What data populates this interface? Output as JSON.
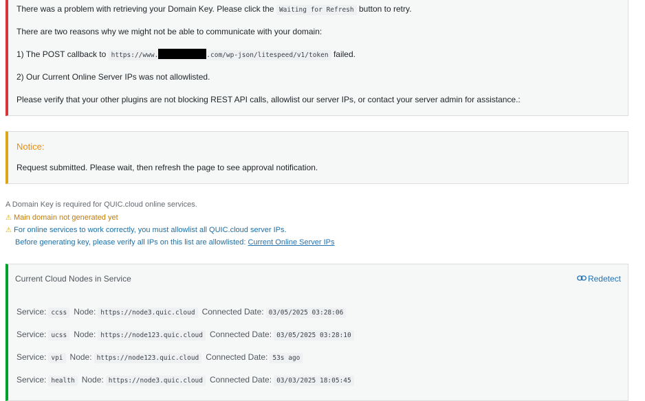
{
  "error": {
    "line1_before": "There was a problem with retrieving your Domain Key. Please click the",
    "line1_code": "Waiting for Refresh",
    "line1_after": "button to retry.",
    "line2": "There are two reasons why we might not be able to communicate with your domain:",
    "reason1_before": "1) The POST callback to",
    "reason1_code_start": "https://www.",
    "reason1_code_end": ".com/wp-json/litespeed/v1/token",
    "reason1_after": "failed.",
    "reason2": "2) Our Current Online Server IPs was not allowlisted.",
    "line3": "Please verify that your other plugins are not blocking REST API calls, allowlist our server IPs, or contact your server admin for assistance.:"
  },
  "notice": {
    "title": "Notice:",
    "message": "Request submitted. Please wait, then refresh the page to see approval notification."
  },
  "domain_info": {
    "required": "A Domain Key is required for QUIC.cloud online services.",
    "warning1": "Main domain not generated yet",
    "warning2": "For online services to work correctly, you must allowlist all QUIC.cloud server IPs.",
    "verify_before": "Before generating key, please verify all IPs on this list are allowlisted:",
    "verify_link": "Current Online Server IPs"
  },
  "nodes": {
    "title": "Current Cloud Nodes in Service",
    "redetect": "Redetect",
    "labels": {
      "service": "Service:",
      "node": "Node:",
      "date": "Connected Date:"
    },
    "rows": [
      {
        "service": "ccss",
        "node": "https://node3.quic.cloud",
        "date": "03/05/2025 03:28:06"
      },
      {
        "service": "ucss",
        "node": "https://node123.quic.cloud",
        "date": "03/05/2025 03:28:10"
      },
      {
        "service": "vpi",
        "node": "https://node123.quic.cloud",
        "date": "53s ago"
      },
      {
        "service": "health",
        "node": "https://node3.quic.cloud",
        "date": "03/03/2025 18:05:45"
      }
    ]
  }
}
